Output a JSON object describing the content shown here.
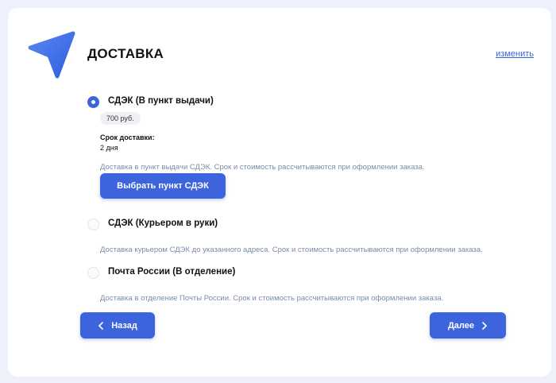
{
  "header": {
    "title": "ДОСТАВКА",
    "change_link": "изменить",
    "logo_icon": "paper-plane-pointer-icon"
  },
  "options": [
    {
      "label": "СДЭК (В пункт выдачи)",
      "selected": true,
      "price": "700 руб.",
      "term_label": "Срок доставки:",
      "term_value": "2 дня",
      "description": "Доставка в пункт выдачи СДЭК. Срок и стоимость рассчитываются при оформлении заказа.",
      "button_label": "Выбрать пункт СДЭК"
    },
    {
      "label": "СДЭК (Курьером в руки)",
      "selected": false,
      "description": "Доставка курьером СДЭК до указанного адреса. Срок и стоимость рассчитываются при оформлении заказа."
    },
    {
      "label": "Почта России (В отделение)",
      "selected": false,
      "description": "Доставка в отделение Почты России. Срок и стоимость рассчитываются при оформлении заказа."
    }
  ],
  "nav": {
    "back_label": "Назад",
    "next_label": "Далее"
  },
  "colors": {
    "accent": "#3d63dd",
    "page_bg": "#eef1fb",
    "muted_text": "#7a8ba8"
  }
}
